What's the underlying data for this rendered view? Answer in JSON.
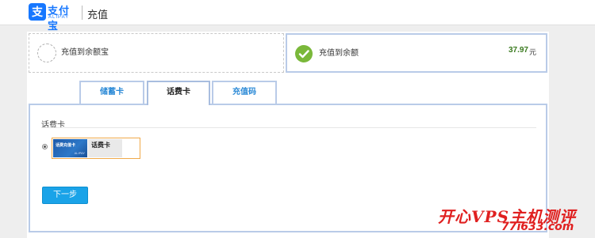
{
  "header": {
    "logo_icon_glyph": "支",
    "logo_text": "支付宝",
    "logo_sub": "ALIPAY",
    "title": "充值",
    "brand_color": "#1677ff"
  },
  "options": [
    {
      "label": "充值到余额宝",
      "icon": "empty-circle-icon",
      "selected": false
    },
    {
      "label": "充值到余额",
      "icon": "check-circle-icon",
      "selected": true,
      "amount": "37.97",
      "unit": "元"
    }
  ],
  "tabs": [
    {
      "label": "储蓄卡",
      "active": false
    },
    {
      "label": "话费卡",
      "active": true
    },
    {
      "label": "充值码",
      "active": false
    }
  ],
  "panel": {
    "title": "话费卡",
    "card": {
      "image_text": "话费充值卡",
      "image_sub": "ALIPAY",
      "label": "话费卡",
      "selected": true
    },
    "next_button": "下一步"
  },
  "watermark": {
    "title": "开心VPS主机测评",
    "url": "77i633.com"
  }
}
